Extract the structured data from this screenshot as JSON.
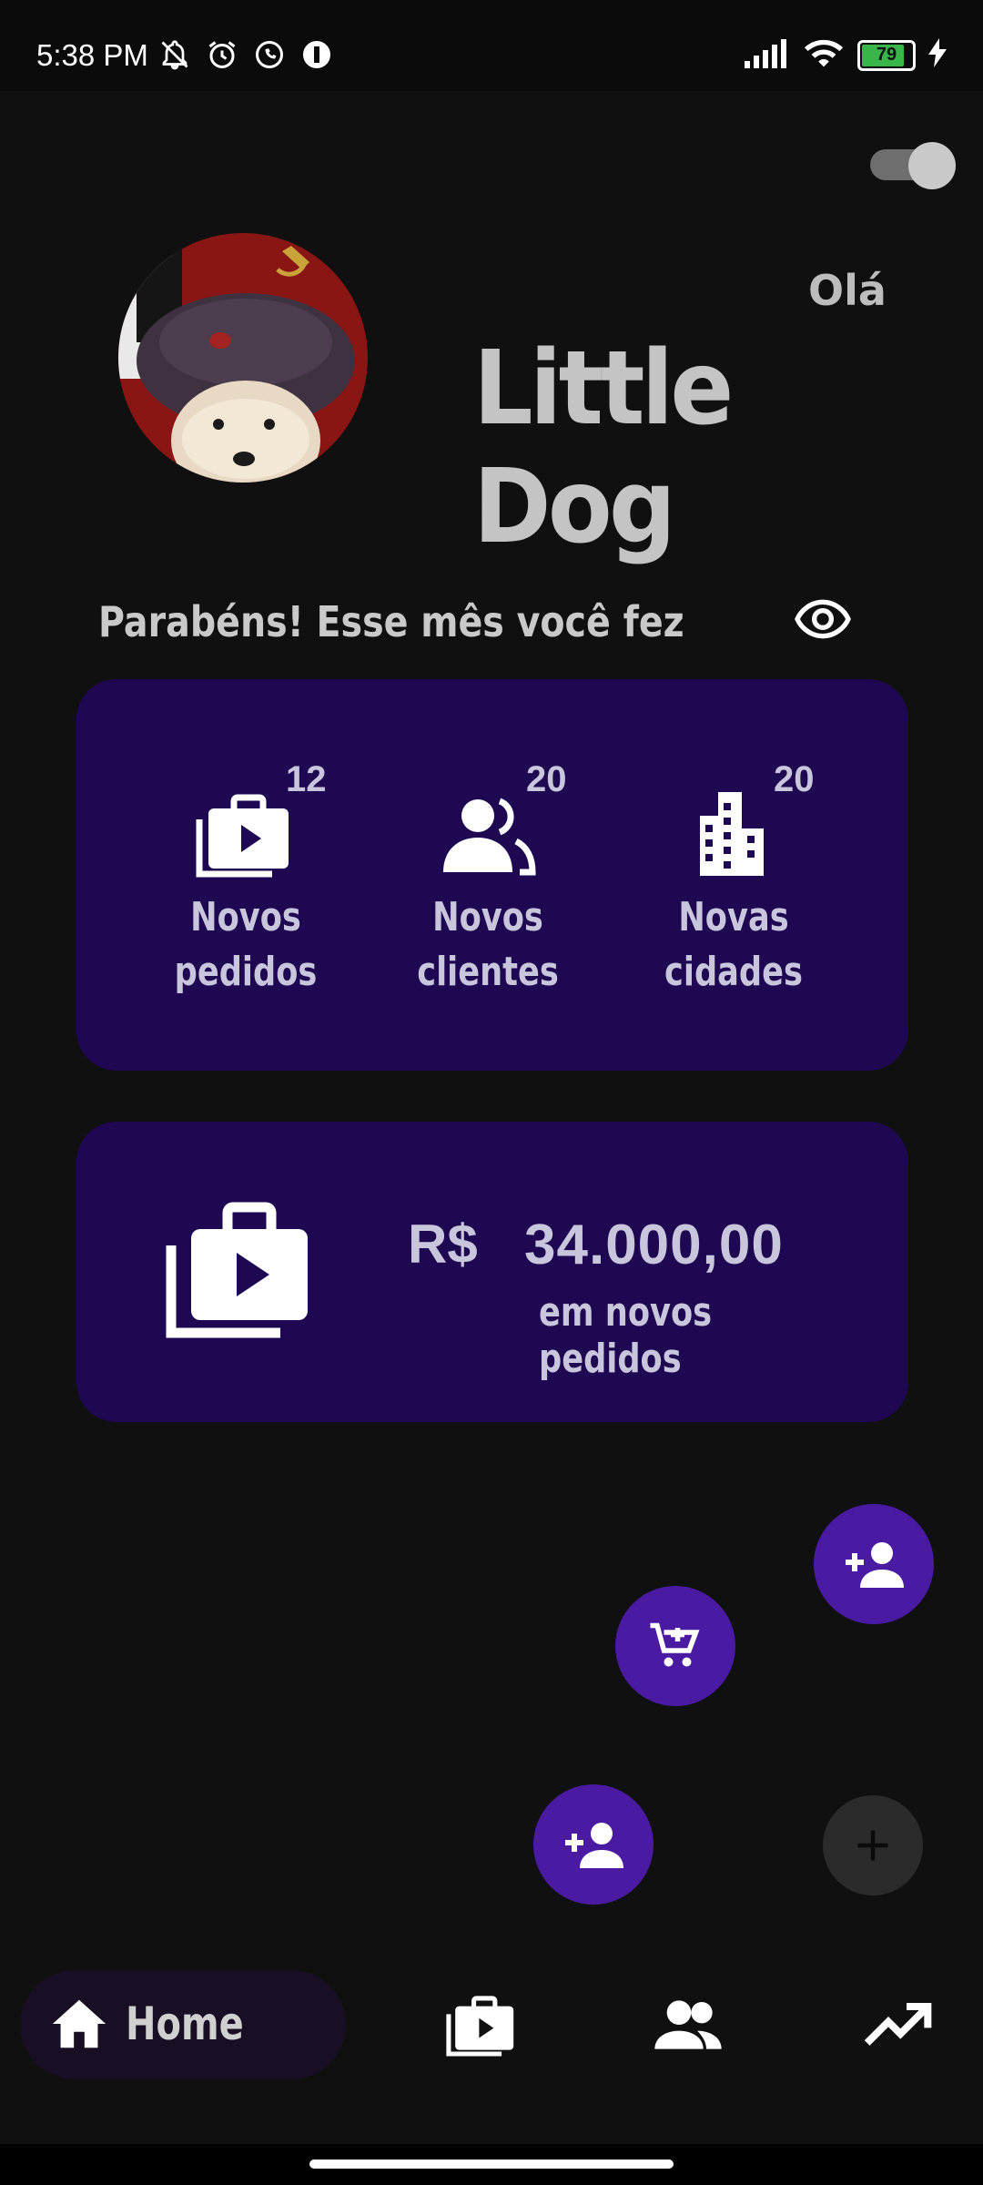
{
  "status_bar": {
    "time": "5:38 PM",
    "battery_level": "79",
    "left_icons": [
      "bell-off-icon",
      "alarm-icon",
      "whatsapp-icon",
      "app-icon"
    ],
    "right_icons": [
      "signal-icon",
      "wifi-icon",
      "battery-icon",
      "charging-icon"
    ]
  },
  "header": {
    "greeting": "Olá",
    "user_name": "Little Dog",
    "theme_toggle_on": true
  },
  "summary": {
    "text": "Parabéns! Esse mês você fez",
    "visibility_icon": "eye-icon"
  },
  "stats": [
    {
      "count": "12",
      "label_line1": "Novos",
      "label_line2": "pedidos",
      "icon": "orders-icon"
    },
    {
      "count": "20",
      "label_line1": "Novos",
      "label_line2": "clientes",
      "icon": "clients-icon"
    },
    {
      "count": "20",
      "label_line1": "Novas",
      "label_line2": "cidades",
      "icon": "city-icon"
    }
  ],
  "revenue": {
    "currency": "R$",
    "amount": "34.000,00",
    "caption": "em novos pedidos"
  },
  "fabs": {
    "add_client_top": "add-client-icon",
    "add_cart": "add-cart-icon",
    "add_client_bottom": "add-client-icon",
    "main": "plus-icon"
  },
  "bottom_nav": {
    "home_label": "Home",
    "items": [
      "home-icon",
      "orders-icon",
      "clients-icon",
      "trending-icon"
    ],
    "active": "Home"
  },
  "colors": {
    "background": "#101010",
    "card": "#1e0852",
    "fab": "#4a1aa3",
    "text_muted": "#c9c5dc"
  }
}
